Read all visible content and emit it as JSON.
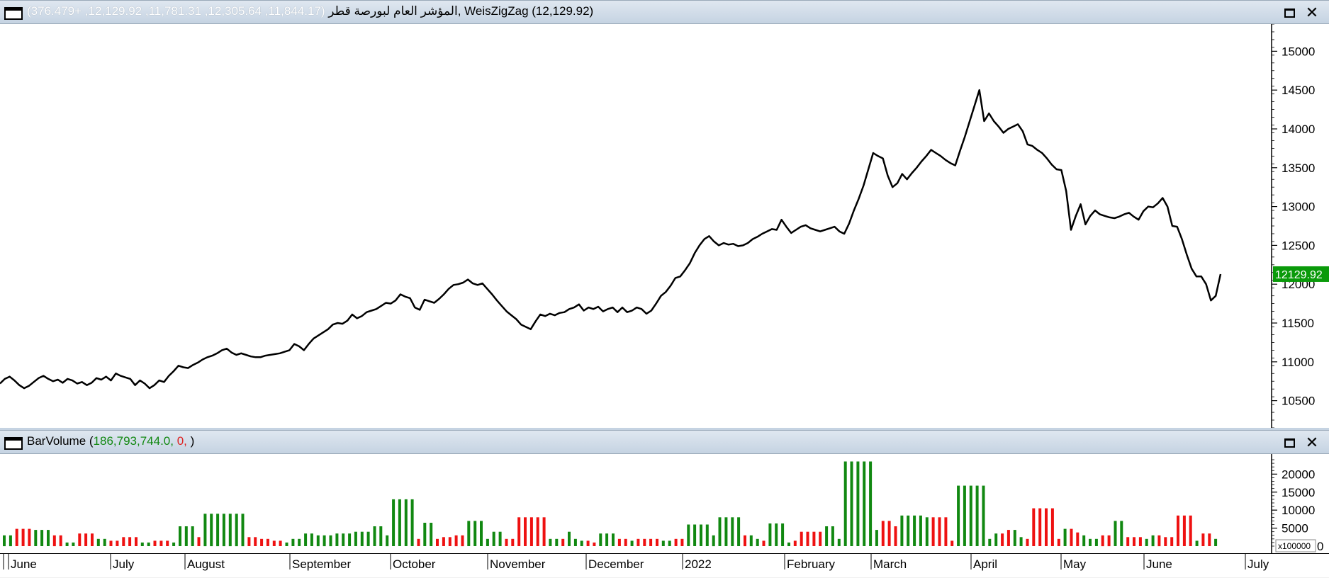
{
  "price_pane": {
    "title_name": "المؤشر العام لبورصة قطر",
    "title_values": "(11,844.17, 12,305.64, 11,781.31, 12,129.92, +376.479)",
    "title_indicator": ", WeisZigZag (12,129.92)",
    "last_value_label": "12129.92",
    "colors": {
      "line": "#000000",
      "last_badge_bg": "#0a9a0a",
      "last_badge_text": "#ffffff"
    }
  },
  "volume_pane": {
    "title_name": "BarVolume (",
    "title_value_green": "186,793,744.0,",
    "title_value_red": " 0,",
    "title_close": " )",
    "scale_label": "x100000",
    "colors": {
      "up": "#118811",
      "down": "#ee1111"
    }
  },
  "x_axis": {
    "labels": [
      "June",
      "July",
      "August",
      "September",
      "October",
      "November",
      "December",
      "2022",
      "February",
      "March",
      "April",
      "May",
      "June",
      "July"
    ]
  },
  "chart_data": [
    {
      "type": "line",
      "title": "المؤشر العام لبورصة قطر",
      "ylim": [
        10150,
        15350
      ],
      "yticks": [
        10500,
        11000,
        11500,
        12000,
        12500,
        13000,
        13500,
        14000,
        14500,
        15000
      ],
      "x_start_month": "June 2021",
      "x_end_month": "July 2022",
      "series": [
        {
          "name": "WeisZigZag",
          "values": [
            10720,
            10780,
            10810,
            10760,
            10700,
            10660,
            10690,
            10740,
            10790,
            10820,
            10780,
            10750,
            10770,
            10730,
            10780,
            10760,
            10720,
            10740,
            10700,
            10730,
            10790,
            10770,
            10810,
            10760,
            10850,
            10820,
            10800,
            10780,
            10700,
            10760,
            10720,
            10660,
            10700,
            10760,
            10740,
            10820,
            10880,
            10950,
            10930,
            10920,
            10960,
            10990,
            11030,
            11060,
            11080,
            11110,
            11150,
            11170,
            11120,
            11090,
            11110,
            11090,
            11070,
            11060,
            11060,
            11080,
            11090,
            11100,
            11110,
            11130,
            11150,
            11230,
            11200,
            11150,
            11230,
            11300,
            11340,
            11380,
            11420,
            11480,
            11500,
            11490,
            11530,
            11610,
            11560,
            11590,
            11640,
            11660,
            11680,
            11720,
            11760,
            11750,
            11790,
            11870,
            11840,
            11820,
            11700,
            11670,
            11800,
            11780,
            11760,
            11810,
            11870,
            11940,
            11990,
            12000,
            12020,
            12060,
            12010,
            11990,
            12010,
            11940,
            11870,
            11790,
            11720,
            11650,
            11600,
            11550,
            11480,
            11450,
            11420,
            11520,
            11610,
            11590,
            11620,
            11600,
            11630,
            11640,
            11680,
            11700,
            11740,
            11660,
            11700,
            11680,
            11710,
            11650,
            11680,
            11700,
            11640,
            11700,
            11640,
            11660,
            11700,
            11680,
            11620,
            11660,
            11750,
            11850,
            11900,
            11980,
            12080,
            12100,
            12180,
            12270,
            12400,
            12500,
            12580,
            12620,
            12550,
            12500,
            12530,
            12510,
            12520,
            12490,
            12500,
            12530,
            12580,
            12610,
            12650,
            12680,
            12710,
            12700,
            12830,
            12740,
            12660,
            12700,
            12740,
            12760,
            12720,
            12700,
            12680,
            12700,
            12720,
            12740,
            12680,
            12650,
            12780,
            12950,
            13100,
            13270,
            13480,
            13690,
            13650,
            13620,
            13400,
            13250,
            13300,
            13420,
            13350,
            13430,
            13500,
            13580,
            13650,
            13730,
            13690,
            13650,
            13600,
            13560,
            13530,
            13720,
            13900,
            14100,
            14300,
            14500,
            14100,
            14200,
            14100,
            14030,
            13950,
            14000,
            14030,
            14060,
            13970,
            13800,
            13780,
            13730,
            13690,
            13620,
            13540,
            13480,
            13470,
            13200,
            12700,
            12880,
            13030,
            12770,
            12880,
            12950,
            12900,
            12880,
            12860,
            12850,
            12870,
            12900,
            12920,
            12870,
            12830,
            12940,
            13000,
            12990,
            13040,
            13110,
            13000,
            12750,
            12740,
            12580,
            12380,
            12200,
            12100,
            12100,
            12000,
            11790,
            11850,
            12130
          ]
        }
      ]
    },
    {
      "type": "bar",
      "title": "BarVolume",
      "ylabel": "x100000",
      "ylim": [
        0,
        24000
      ],
      "yticks": [
        0,
        5000,
        10000,
        15000,
        20000
      ],
      "series": [
        {
          "name": "BarVolume",
          "values": [
            3000,
            3000,
            4800,
            4800,
            4800,
            4500,
            4500,
            4500,
            3000,
            3000,
            1000,
            1000,
            3500,
            3500,
            3500,
            2000,
            2000,
            1500,
            1500,
            2500,
            2500,
            2500,
            1000,
            1000,
            1500,
            1500,
            1500,
            1000,
            5500,
            5500,
            5500,
            2500,
            9000,
            9000,
            9000,
            9000,
            9000,
            9000,
            9000,
            2500,
            2500,
            2000,
            2000,
            1500,
            1500,
            1000,
            2000,
            2000,
            3500,
            3500,
            3000,
            3000,
            3000,
            3500,
            3500,
            3500,
            4000,
            4000,
            4000,
            5500,
            5500,
            3000,
            13000,
            13000,
            13000,
            13000,
            2000,
            6500,
            6500,
            2000,
            2500,
            2500,
            3000,
            3000,
            7000,
            7000,
            7000,
            2000,
            4000,
            4000,
            2000,
            2000,
            8000,
            8000,
            8000,
            8000,
            8000,
            2000,
            2000,
            2000,
            4000,
            2000,
            1500,
            1500,
            1000,
            3500,
            3500,
            3500,
            2000,
            2000,
            1500,
            2000,
            2000,
            2000,
            2000,
            1500,
            1500,
            2000,
            2000,
            6000,
            6000,
            6000,
            6000,
            3000,
            8000,
            8000,
            8000,
            8000,
            3000,
            3000,
            2000,
            1500,
            6300,
            6300,
            6300,
            1000,
            1500,
            4000,
            4000,
            4000,
            4000,
            5500,
            5500,
            2000,
            23500,
            23500,
            23500,
            23500,
            23500,
            4500,
            7000,
            7000,
            5500,
            8500,
            8500,
            8500,
            8500,
            8000,
            8000,
            8000,
            8000,
            1500,
            16800,
            16800,
            16800,
            16800,
            16800,
            2000,
            3500,
            3500,
            4500,
            4500,
            2500,
            2000,
            10500,
            10500,
            10500,
            10500,
            2000,
            4800,
            4800,
            3800,
            3000,
            2000,
            2000,
            3000,
            3000,
            7000,
            7000,
            2500,
            2500,
            2500,
            2000,
            3000,
            3000,
            2500,
            2500,
            8500,
            8500,
            8500,
            1500,
            3500,
            3500,
            2000
          ],
          "colors": [
            "up",
            "up",
            "down",
            "down",
            "down",
            "up",
            "up",
            "up",
            "down",
            "down",
            "up",
            "up",
            "down",
            "down",
            "down",
            "up",
            "up",
            "down",
            "down",
            "down",
            "down",
            "down",
            "up",
            "up",
            "down",
            "down",
            "down",
            "up",
            "up",
            "up",
            "up",
            "down",
            "up",
            "up",
            "up",
            "up",
            "up",
            "up",
            "up",
            "down",
            "down",
            "down",
            "down",
            "down",
            "down",
            "up",
            "up",
            "up",
            "up",
            "up",
            "up",
            "up",
            "up",
            "up",
            "up",
            "up",
            "up",
            "up",
            "up",
            "up",
            "up",
            "up",
            "up",
            "up",
            "up",
            "up",
            "down",
            "up",
            "up",
            "down",
            "down",
            "down",
            "down",
            "down",
            "up",
            "up",
            "up",
            "up",
            "up",
            "up",
            "down",
            "down",
            "down",
            "down",
            "down",
            "down",
            "down",
            "up",
            "up",
            "down",
            "up",
            "up",
            "up",
            "down",
            "down",
            "up",
            "up",
            "up",
            "down",
            "down",
            "up",
            "down",
            "down",
            "down",
            "down",
            "up",
            "up",
            "down",
            "down",
            "up",
            "up",
            "up",
            "up",
            "up",
            "up",
            "up",
            "up",
            "up",
            "down",
            "up",
            "up",
            "down",
            "up",
            "up",
            "up",
            "up",
            "down",
            "down",
            "down",
            "down",
            "down",
            "up",
            "up",
            "up",
            "up",
            "up",
            "up",
            "up",
            "up",
            "up",
            "down",
            "down",
            "down",
            "up",
            "up",
            "up",
            "up",
            "up",
            "down",
            "down",
            "down",
            "down",
            "up",
            "up",
            "up",
            "up",
            "up",
            "up",
            "up",
            "down",
            "down",
            "up",
            "up",
            "down",
            "down",
            "down",
            "down",
            "down",
            "down",
            "up",
            "down",
            "down",
            "up",
            "up",
            "up",
            "down",
            "down",
            "up",
            "up",
            "down",
            "down",
            "down",
            "up",
            "up",
            "down",
            "down",
            "down",
            "down",
            "down",
            "down",
            "up",
            "down",
            "down",
            "up"
          ]
        }
      ]
    }
  ]
}
